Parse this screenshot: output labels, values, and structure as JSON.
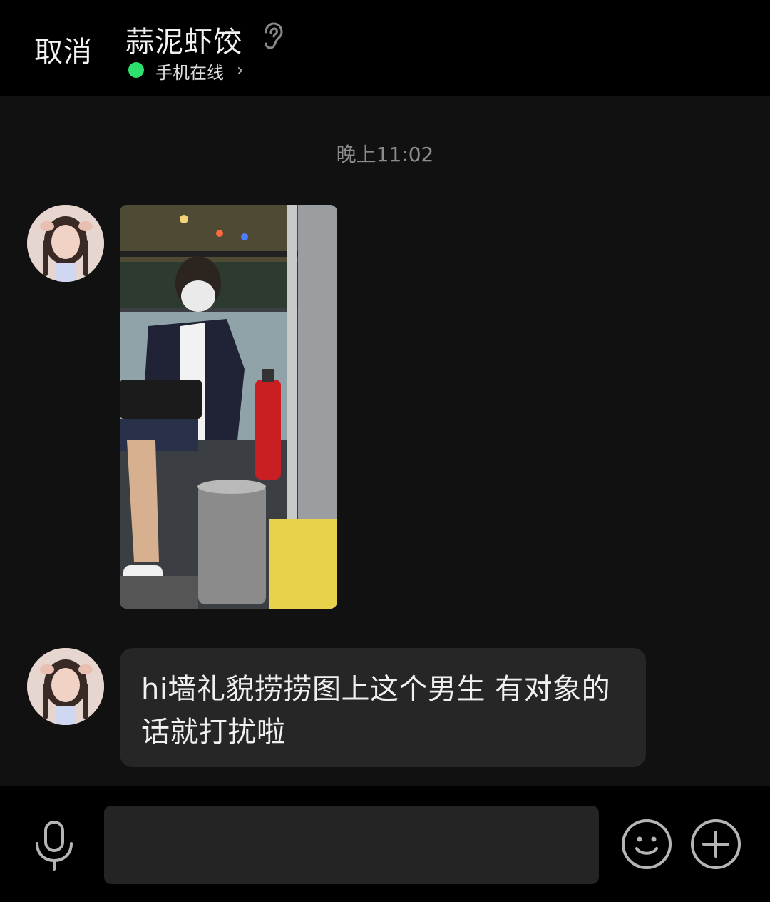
{
  "header": {
    "cancel_label": "取消",
    "title": "蒜泥虾饺",
    "status": "手机在线",
    "status_chevron": "›",
    "status_color": "#2ddf6c",
    "ear_icon": "ear-icon"
  },
  "chat": {
    "timestamp": "晚上11:02",
    "messages": [
      {
        "type": "image",
        "sender": "contact",
        "description_icon": "photo"
      },
      {
        "type": "text",
        "sender": "contact",
        "text": "hi墙礼貌捞捞图上这个男生 有对象的话就打扰啦"
      }
    ]
  },
  "input": {
    "placeholder": "",
    "icons": [
      "microphone-icon",
      "emoji-icon",
      "plus-icon"
    ]
  }
}
